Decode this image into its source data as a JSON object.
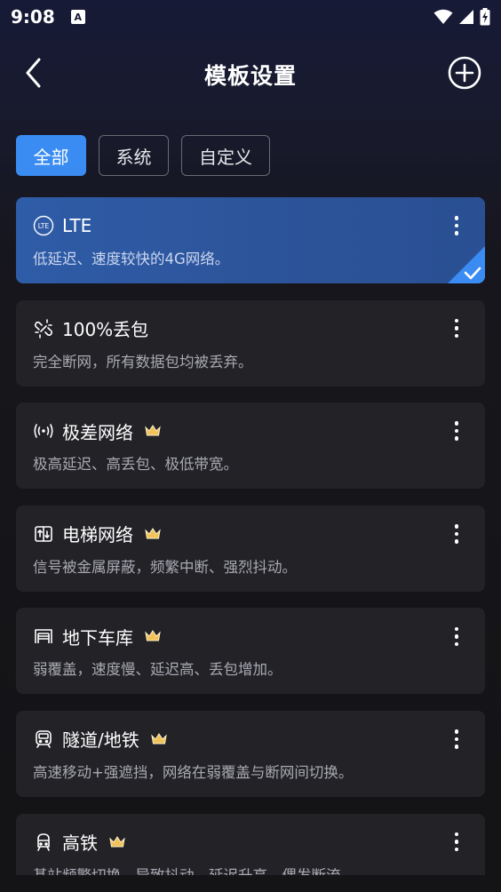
{
  "status_bar": {
    "time": "9:08",
    "notification_icon": "A"
  },
  "header": {
    "title": "模板设置",
    "back_icon": "chevron-left-icon",
    "add_icon": "plus-circle-icon"
  },
  "tabs": [
    {
      "label": "全部",
      "active": true
    },
    {
      "label": "系统",
      "active": false
    },
    {
      "label": "自定义",
      "active": false
    }
  ],
  "templates": [
    {
      "icon": "lte-icon",
      "title": "LTE",
      "desc": "低延迟、速度较快的4G网络。",
      "premium": false,
      "selected": true
    },
    {
      "icon": "broken-link-icon",
      "title": "100%丢包",
      "desc": "完全断网，所有数据包均被丢弃。",
      "premium": false,
      "selected": false
    },
    {
      "icon": "signal-waves-icon",
      "title": "极差网络",
      "desc": "极高延迟、高丢包、极低带宽。",
      "premium": true,
      "selected": false
    },
    {
      "icon": "elevator-icon",
      "title": "电梯网络",
      "desc": "信号被金属屏蔽，频繁中断、强烈抖动。",
      "premium": true,
      "selected": false
    },
    {
      "icon": "garage-icon",
      "title": "地下车库",
      "desc": "弱覆盖，速度慢、延迟高、丢包增加。",
      "premium": true,
      "selected": false
    },
    {
      "icon": "subway-icon",
      "title": "隧道/地铁",
      "desc": "高速移动+强遮挡，网络在弱覆盖与断网间切换。",
      "premium": true,
      "selected": false
    },
    {
      "icon": "train-icon",
      "title": "高铁",
      "desc": "基站频繁切换，导致抖动、延迟升高、偶发断流。",
      "premium": true,
      "selected": false
    }
  ],
  "colors": {
    "accent": "#3b8cf2",
    "selected_card": "#2f5ca7",
    "card_bg": "#222227",
    "crown": "#f2c25a"
  }
}
